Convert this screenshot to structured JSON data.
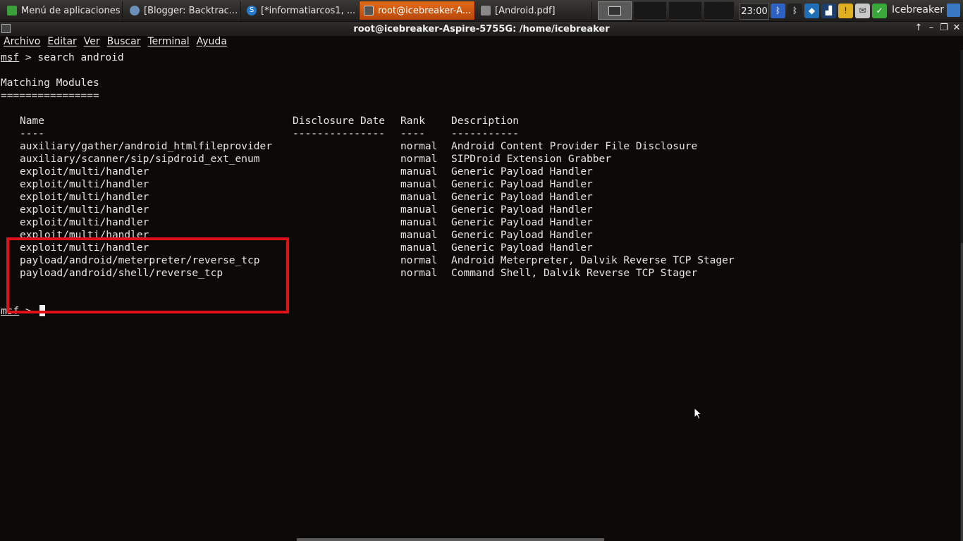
{
  "taskbar": {
    "tasks": [
      {
        "label": "Menú de aplicaciones",
        "color": "#3aa13a"
      },
      {
        "label": "[Blogger: Backtrac...",
        "color": "#6b8fb8"
      },
      {
        "label": "[*informatiarcos1, ...",
        "color": "#2a78c8"
      },
      {
        "label": "root@icebreaker-A...",
        "color": "#555555"
      },
      {
        "label": "[Android.pdf]",
        "color": "#888888"
      }
    ],
    "clock": "23:00",
    "user": "Icebreaker",
    "accent": "#e26b16"
  },
  "window": {
    "title": "root@icebreaker-Aspire-5755G: /home/icebreaker",
    "menus": [
      "Archivo",
      "Editar",
      "Ver",
      "Buscar",
      "Terminal",
      "Ayuda"
    ]
  },
  "terminal": {
    "prompt": "msf",
    "prompt_sep": " > ",
    "command": "search android",
    "heading": "Matching Modules",
    "heading_rule": "================",
    "columns": [
      "Name",
      "Disclosure Date",
      "Rank",
      "Description"
    ],
    "column_rules": [
      "----",
      "---------------",
      "----",
      "-----------"
    ],
    "rows": [
      {
        "name": "auxiliary/gather/android_htmlfileprovider",
        "date": "",
        "rank": "normal",
        "desc": "Android Content Provider File Disclosure"
      },
      {
        "name": "auxiliary/scanner/sip/sipdroid_ext_enum",
        "date": "",
        "rank": "normal",
        "desc": "SIPDroid Extension Grabber"
      },
      {
        "name": "exploit/multi/handler",
        "date": "",
        "rank": "manual",
        "desc": "Generic Payload Handler"
      },
      {
        "name": "exploit/multi/handler",
        "date": "",
        "rank": "manual",
        "desc": "Generic Payload Handler"
      },
      {
        "name": "exploit/multi/handler",
        "date": "",
        "rank": "manual",
        "desc": "Generic Payload Handler"
      },
      {
        "name": "exploit/multi/handler",
        "date": "",
        "rank": "manual",
        "desc": "Generic Payload Handler"
      },
      {
        "name": "exploit/multi/handler",
        "date": "",
        "rank": "manual",
        "desc": "Generic Payload Handler"
      },
      {
        "name": "exploit/multi/handler",
        "date": "",
        "rank": "manual",
        "desc": "Generic Payload Handler"
      },
      {
        "name": "exploit/multi/handler",
        "date": "",
        "rank": "manual",
        "desc": "Generic Payload Handler"
      },
      {
        "name": "payload/android/meterpreter/reverse_tcp",
        "date": "",
        "rank": "normal",
        "desc": "Android Meterpreter, Dalvik Reverse TCP Stager"
      },
      {
        "name": "payload/android/shell/reverse_tcp",
        "date": "",
        "rank": "normal",
        "desc": "Command Shell, Dalvik Reverse TCP Stager"
      }
    ],
    "highlight_color": "#e0101a"
  }
}
